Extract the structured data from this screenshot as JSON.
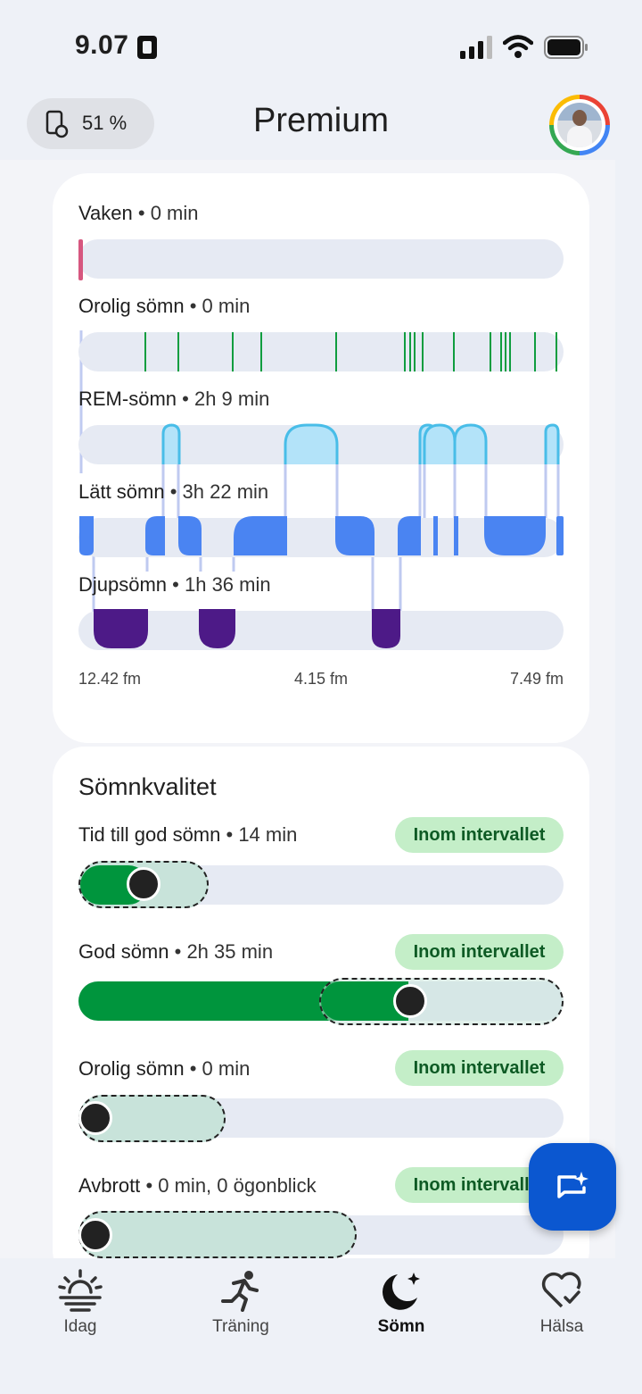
{
  "status_bar": {
    "time": "9.07"
  },
  "header": {
    "battery": "51 %",
    "title": "Premium"
  },
  "sleep_stages": {
    "rows": [
      {
        "label": "Vaken",
        "duration": "• 0 min"
      },
      {
        "label": "Orolig sömn",
        "duration": "• 0 min"
      },
      {
        "label": "REM-sömn",
        "duration": "• 2h 9 min"
      },
      {
        "label": "Lätt sömn",
        "duration": "• 3h 22 min"
      },
      {
        "label": "Djupsömn",
        "duration": "• 1h 36 min"
      }
    ],
    "time_axis": [
      "12.42 fm",
      "4.15 fm",
      "7.49 fm"
    ]
  },
  "quality": {
    "title": "Sömnkvalitet",
    "rows": [
      {
        "label": "Tid till god sömn",
        "duration": "• 14 min",
        "badge": "Inom intervallet"
      },
      {
        "label": "God sömn",
        "duration": "• 2h 35 min",
        "badge": "Inom intervallet"
      },
      {
        "label": "Orolig sömn",
        "duration": "• 0 min",
        "badge": "Inom intervallet"
      },
      {
        "label": "Avbrott",
        "duration": "• 0 min, 0 ögonblick",
        "badge": "Inom intervallet"
      }
    ]
  },
  "bottom_nav": [
    {
      "label": "Idag",
      "icon": "sunrise-icon"
    },
    {
      "label": "Träning",
      "icon": "running-icon"
    },
    {
      "label": "Sömn",
      "icon": "moon-icon",
      "active": true
    },
    {
      "label": "Hälsa",
      "icon": "heart-check-icon"
    }
  ],
  "colors": {
    "awake": "#d6577f",
    "restless": "#0f9d3f",
    "rem": "#b3e3f9",
    "rem_border": "#48bde8",
    "light": "#4a84f2",
    "deep": "#4d1a87",
    "good": "#00953d",
    "badge": "#c4eec8",
    "fab": "#0b57d0"
  }
}
